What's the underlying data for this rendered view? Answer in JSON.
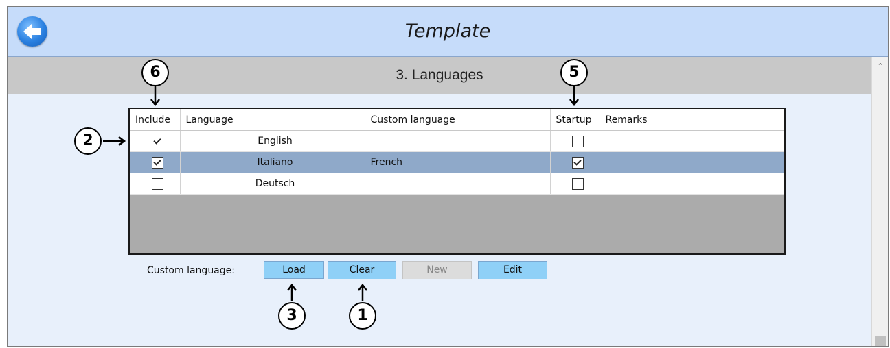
{
  "window": {
    "title": "Template"
  },
  "section": {
    "title": "3. Languages"
  },
  "table": {
    "columns": [
      "Include",
      "Language",
      "Custom language",
      "Startup",
      "Remarks"
    ],
    "rows": [
      {
        "include": true,
        "language": "English",
        "custom_language": "",
        "startup": false,
        "remarks": "",
        "selected": false
      },
      {
        "include": true,
        "language": "Italiano",
        "custom_language": "French",
        "startup": true,
        "remarks": "",
        "selected": true
      },
      {
        "include": false,
        "language": "Deutsch",
        "custom_language": "",
        "startup": false,
        "remarks": "",
        "selected": false
      }
    ]
  },
  "custom_language": {
    "label": "Custom language:",
    "buttons": {
      "load": "Load",
      "clear": "Clear",
      "new": "New",
      "edit": "Edit"
    }
  },
  "callouts": {
    "c1": "1",
    "c2": "2",
    "c3": "3",
    "c5": "5",
    "c6": "6"
  },
  "colors": {
    "title_bar": "#c6dcfa",
    "section_bar": "#c8c8c8",
    "selected_row": "#8fa9c9",
    "button": "#8fd0f7"
  },
  "icons": {
    "back": "back-arrow-icon",
    "scroll_up": "chevron-up-icon"
  }
}
